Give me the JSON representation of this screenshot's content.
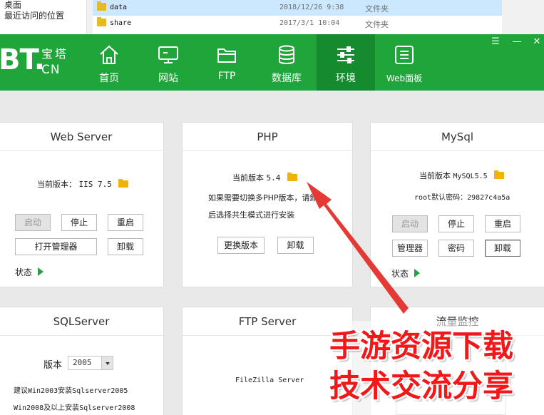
{
  "explorer": {
    "nav_items": [
      "桌面",
      "最近访问的位置"
    ],
    "files": [
      {
        "name": "data",
        "date": "2018/12/26 9:38",
        "type": "文件夹"
      },
      {
        "name": "share",
        "date": "2017/3/1 10:04",
        "type": "文件夹"
      }
    ]
  },
  "header": {
    "logo_bt": "BT.",
    "logo_cn_top": "宝塔",
    "logo_cn_bottom": "CN",
    "nav": [
      {
        "label": "首页",
        "icon": "home-icon"
      },
      {
        "label": "网站",
        "icon": "monitor-icon"
      },
      {
        "label": "FTP",
        "icon": "folder-icon"
      },
      {
        "label": "数据库",
        "icon": "database-icon"
      },
      {
        "label": "环境",
        "icon": "sliders-icon"
      },
      {
        "label": "Web面板",
        "icon": "list-icon"
      }
    ],
    "active_nav": "环境",
    "window_controls": [
      "menu-icon",
      "minimize-icon",
      "close-icon"
    ]
  },
  "cards": {
    "web": {
      "title": "Web Server",
      "version_label": "当前版本：",
      "version_value": "IIS 7.5",
      "buttons": {
        "start": "启动",
        "stop": "停止",
        "restart": "重启",
        "open_manager": "打开管理器",
        "uninstall": "卸载"
      },
      "status_label": "状态"
    },
    "php": {
      "title": "PHP",
      "version_label": "当前版本",
      "version_value": "5.4",
      "hint_line1": "如果需要切换多PHP版本，请卸载",
      "hint_line2": "后选择共生模式进行安装",
      "buttons": {
        "change_version": "更换版本",
        "uninstall": "卸载"
      }
    },
    "mysql": {
      "title": "MySql",
      "version_label": "当前版本",
      "version_value": "MySQL5.5",
      "root_password": "root默认密码：29827c4a5a",
      "buttons": {
        "start": "启动",
        "stop": "停止",
        "restart": "重启",
        "manager": "管理器",
        "password": "密码",
        "uninstall": "卸载"
      },
      "status_label": "状态"
    },
    "sqlserver": {
      "title": "SQLServer",
      "version_label": "版本",
      "version_value": "2005",
      "hint_line1": "建议Win2003安装Sqlserver2005",
      "hint_line2": "Win2008及以上安装Sqlserver2008"
    },
    "ftp": {
      "title": "FTP Server",
      "software": "FileZilla Server"
    },
    "traffic": {
      "title": "流量监控"
    }
  },
  "watermark": {
    "line1": "手游资源下载",
    "line2": "技术交流分享"
  },
  "colors": {
    "brand_green": "#20a53a",
    "active_nav_green": "#168a2e",
    "watermark_red": "#f01818",
    "arrow_red": "#e53935",
    "folder_yellow": "#f0b400"
  }
}
